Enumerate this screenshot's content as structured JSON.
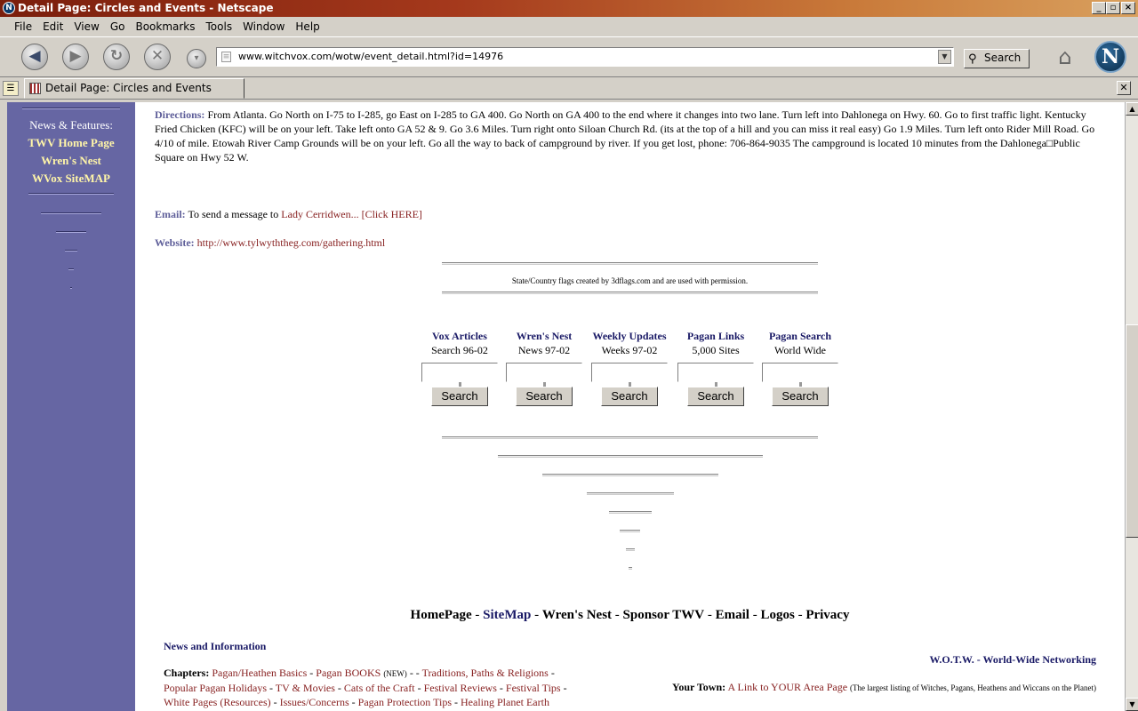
{
  "window": {
    "title": "Detail Page: Circles and Events - Netscape"
  },
  "menu": [
    "File",
    "Edit",
    "View",
    "Go",
    "Bookmarks",
    "Tools",
    "Window",
    "Help"
  ],
  "nav": {
    "url": "www.witchvox.com/wotw/event_detail.html?id=14976",
    "search_label": "Search"
  },
  "tab": {
    "label": "Detail Page: Circles and Events"
  },
  "sidebar": {
    "heading": "News & Features:",
    "links": [
      "TWV Home Page",
      "Wren's Nest",
      "WVox SiteMAP"
    ]
  },
  "directions": {
    "label": "Directions:",
    "text": "From Atlanta. Go North on I-75 to I-285, go East on I-285 to GA 400. Go North on GA 400 to the end where it changes into two lane. Turn left into Dahlonega on Hwy. 60. Go to first traffic light. Kentucky Fried Chicken (KFC) will be on your left. Take left onto GA 52 & 9. Go 3.6 Miles. Turn right onto Siloan Church Rd. (its at the top of a hill and you can miss it real easy) Go 1.9 Miles. Turn left onto Rider Mill Road. Go 4/10 of mile. Etowah River Camp Grounds will be on your left. Go all the way to back of campground by river. If you get lost, phone: 706-864-9035 The campground is located 10 minutes from the Dahlonega□Public Square on Hwy 52 W."
  },
  "email": {
    "label": "Email:",
    "prefix": "To send a message to",
    "name": "Lady Cerridwen...",
    "click": "[Click HERE]"
  },
  "website": {
    "label": "Website:",
    "url": "http://www.tylwyththeg.com/gathering.html"
  },
  "flags_note": "State/Country flags created by 3dflags.com and are used with permission.",
  "search_boxes": [
    {
      "title": "Vox Articles",
      "sub": "Search 96-02",
      "button": "Search"
    },
    {
      "title": "Wren's Nest",
      "sub": "News 97-02",
      "button": "Search"
    },
    {
      "title": "Weekly Updates",
      "sub": "Weeks 97-02",
      "button": "Search"
    },
    {
      "title": "Pagan Links",
      "sub": "5,000 Sites",
      "button": "Search"
    },
    {
      "title": "Pagan Search",
      "sub": "World Wide",
      "button": "Search"
    }
  ],
  "footer_nav": {
    "home": "HomePage",
    "sitemap": "SiteMap",
    "wrens": "Wren's Nest",
    "sponsor": "Sponsor TWV",
    "email": "Email",
    "logos": "Logos",
    "privacy": "Privacy",
    "sep": " - "
  },
  "news_info": "News and Information",
  "chapters": {
    "label": "Chapters:",
    "l1": "Pagan/Heathen Basics",
    "l2": "Pagan BOOKS",
    "l2new": "(NEW)",
    "l3": "Traditions, Paths & Religions",
    "l4": "Popular Pagan Holidays",
    "l5": "TV & Movies",
    "l6": "Cats of the Craft",
    "l7": "Festival Reviews",
    "l8": "Festival Tips",
    "l9": "White Pages (Resources)",
    "l10": "Issues/Concerns",
    "l11": "Pagan Protection Tips",
    "l12": "Healing Planet Earth"
  },
  "wotw": "W.O.T.W. - World-Wide Networking",
  "your_town": {
    "label": "Your Town:",
    "link": "A Link to YOUR Area Page",
    "note": "(The largest listing of Witches, Pagans, Heathens and Wiccans on the Planet)"
  }
}
